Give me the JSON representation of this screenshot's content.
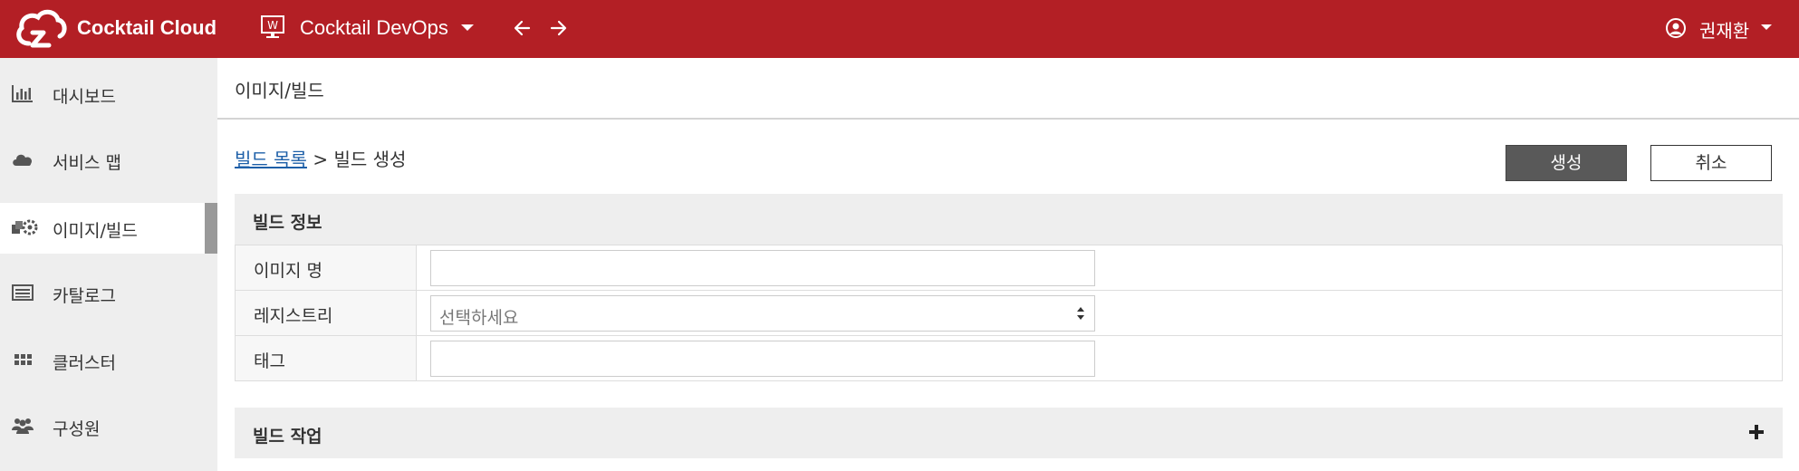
{
  "topbar": {
    "brand": "Cocktail Cloud",
    "workspace": "Cocktail DevOps",
    "workspace_icon_letter": "W",
    "user": "권재환",
    "color": "#b31f25"
  },
  "sidebar": {
    "items": [
      {
        "label": "대시보드",
        "icon": "bar-chart-icon"
      },
      {
        "label": "서비스 맵",
        "icon": "cloud-icon"
      },
      {
        "label": "이미지/빌드",
        "icon": "gears-icon",
        "active": true
      },
      {
        "label": "카탈로그",
        "icon": "catalog-icon"
      },
      {
        "label": "클러스터",
        "icon": "grid-icon"
      },
      {
        "label": "구성원",
        "icon": "users-icon"
      }
    ]
  },
  "page": {
    "title": "이미지/빌드"
  },
  "breadcrumb": {
    "link": "빌드 목록",
    "separator": ">",
    "current": "빌드 생성"
  },
  "buttons": {
    "create": "생성",
    "cancel": "취소"
  },
  "build_info": {
    "title": "빌드 정보",
    "rows": [
      {
        "label": "이미지 명",
        "value": ""
      },
      {
        "label": "레지스트리",
        "placeholder": "선택하세요"
      },
      {
        "label": "태그",
        "value": ""
      }
    ]
  },
  "build_tasks": {
    "title": "빌드 작업"
  }
}
